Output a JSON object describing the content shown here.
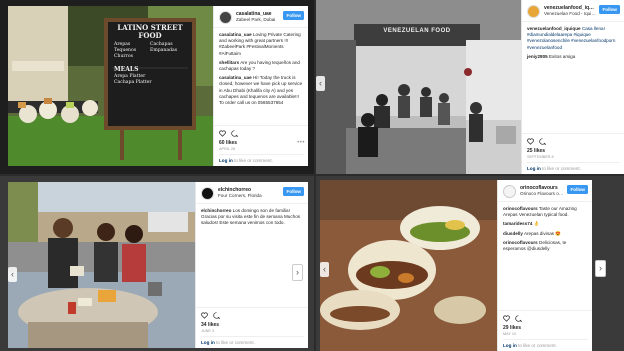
{
  "posts": [
    {
      "username": "casalatina_uae",
      "location": "Zabeel Park, Dubai",
      "follow_label": "Follow",
      "comments": [
        {
          "user": "casalatina_uae",
          "text": "Loving Private Catering and working with great partners !!! #ZabeelPark #FestivalMoments #AlFuttaim"
        },
        {
          "user": "shellitars",
          "text": "Are you having tequeños and cachapas today ?"
        },
        {
          "user": "casalatina_uae",
          "text": "Hi! Today the truck is closed, however we have pick up service in Abu Dhabi (Khalifa city A) and yes cachapes and tequenos are available!!! To order call us on 0565537654"
        }
      ],
      "likes": "60 likes",
      "date": "APRIL 28",
      "login_link": "Log in",
      "login_rest": "to like or comment.",
      "menu_board": [
        "LATINO STREET FOOD",
        "Arepas",
        "Cachapas",
        "Tequenos",
        "Empanadas",
        "Churros",
        "MEALS",
        "Arepa Platter",
        "Cachapa Platter"
      ]
    },
    {
      "username": "venezuelanfood_iquique",
      "location": "Venezuelan Food - Iquique",
      "follow_label": "Follow",
      "storefront": "VENEZUELAN FOOD",
      "comments": [
        {
          "user": "venezuelanfood_iquique",
          "text": "Casa llena! #diamundialdelaarepa #iquique #venezolanosenchile #venezuelanfoodporn #venezuelanfood"
        },
        {
          "user": "jeniy2805",
          "text": "Exitos amiga"
        }
      ],
      "likes": "25 likes",
      "date": "SEPTEMBER 8",
      "login_link": "Log in",
      "login_rest": "to like or comment."
    },
    {
      "username": "elchinchorreo",
      "location": "Four Corners, Florida",
      "follow_label": "Follow",
      "comments": [
        {
          "user": "elchinchorreo",
          "text": "Los domingo son de familia! Gracias por su visita este fin de semana Muchos saludos! Este semana venimos con todo."
        }
      ],
      "likes": "34 likes",
      "date": "JUNE 3",
      "login_link": "Log in",
      "login_rest": "to like or comment."
    },
    {
      "username": "orinocoflavours",
      "location": "Orinoco Flavours of L...",
      "follow_label": "Follow",
      "comments": [
        {
          "user": "orinocoflavours",
          "text": "Taste our Amazing Arepas Venezuelan typical food."
        },
        {
          "user": "tamaridess74",
          "text": "👌"
        },
        {
          "user": "diusdelly",
          "text": "Arepas divinas 😍"
        },
        {
          "user": "orinocoflavours",
          "text": "Deliciosas, te esperamos @diusdelly"
        }
      ],
      "likes": "29 likes",
      "date": "MAY 10",
      "login_link": "Log in",
      "login_rest": "to like or comment."
    }
  ],
  "colors": {
    "follow": "#3897f0",
    "link": "#003569"
  },
  "icons": [
    "heart-icon",
    "comment-icon",
    "chevron-left-icon",
    "chevron-right-icon",
    "more-options-icon"
  ]
}
